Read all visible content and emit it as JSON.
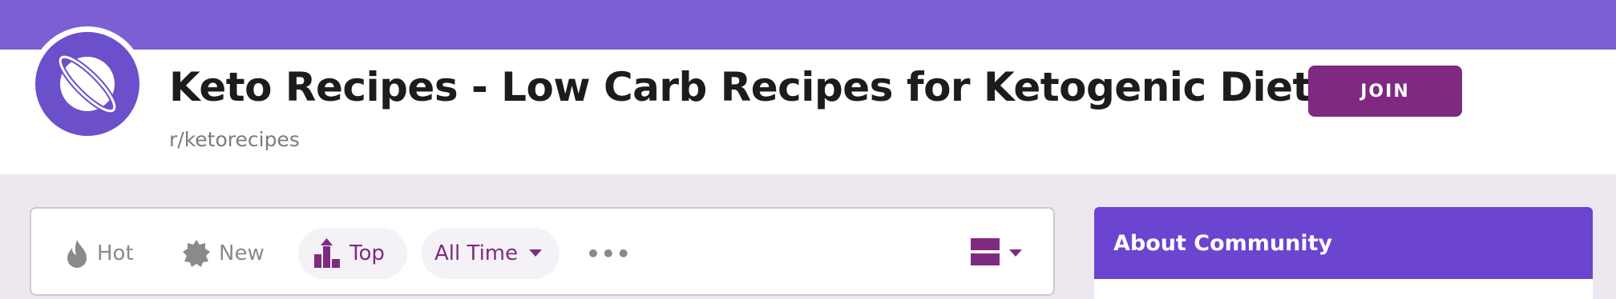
{
  "header": {
    "title": "Keto Recipes - Low Carb Recipes for Ketogenic Diets",
    "subreddit": "r/ketorecipes",
    "join_label": "JOIN"
  },
  "sort": {
    "hot": "Hot",
    "new": "New",
    "top": "Top",
    "timeframe": "All Time",
    "more": "•••"
  },
  "sidebar": {
    "about_title": "About Community"
  },
  "colors": {
    "banner": "#7c5fd3",
    "accent": "#7f2a80",
    "about_header": "#6b44d0"
  },
  "icons": [
    "planet-icon",
    "flame-icon",
    "new-badge-icon",
    "top-bars-icon",
    "caret-down-icon",
    "card-layout-icon"
  ]
}
